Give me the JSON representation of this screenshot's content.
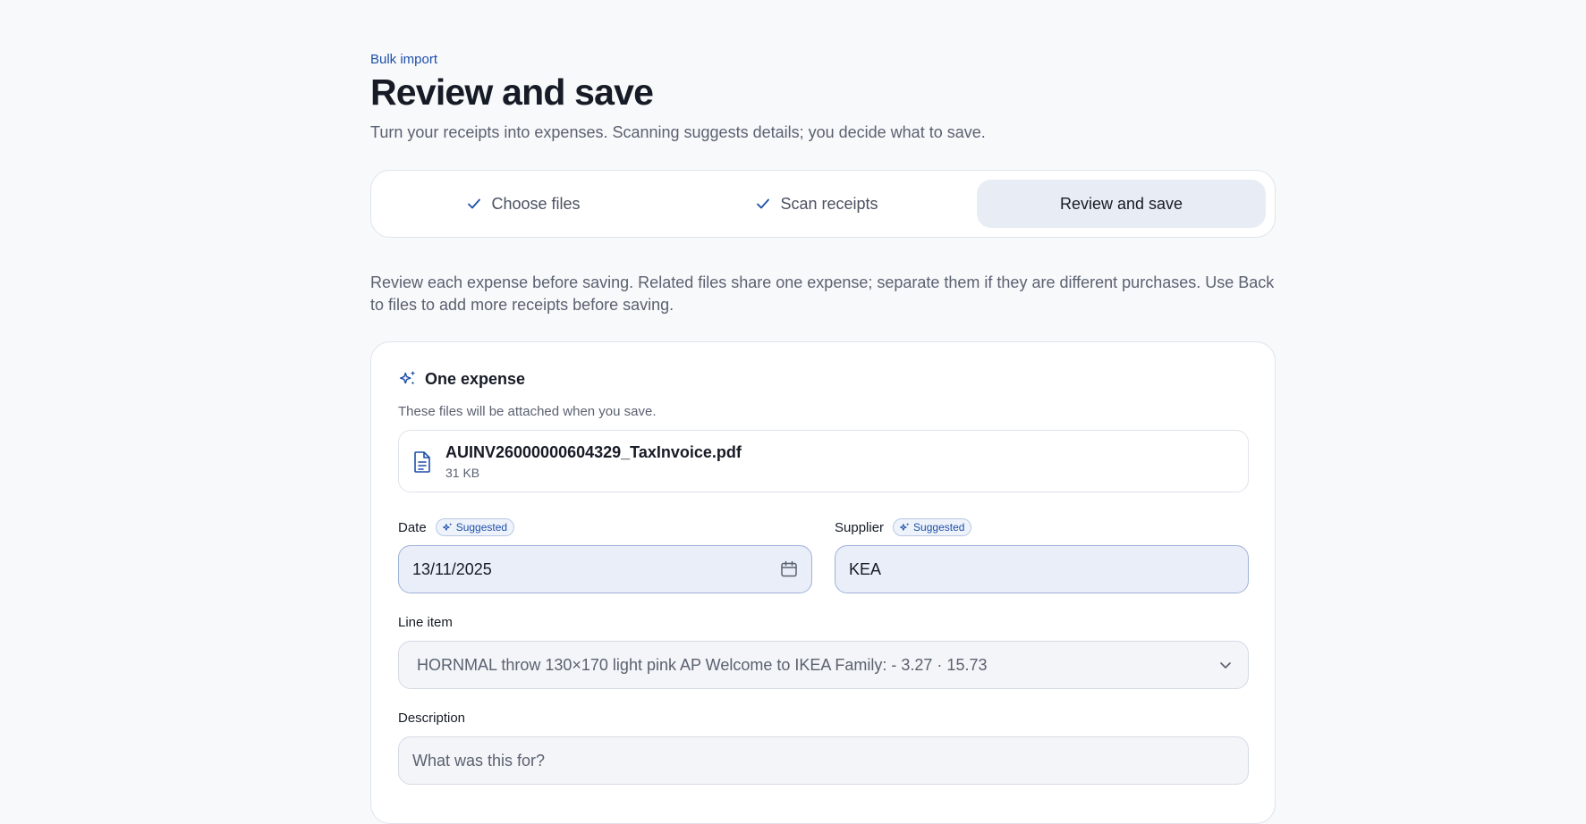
{
  "header": {
    "eyebrow": "Bulk import",
    "title": "Review and save",
    "subtitle": "Turn your receipts into expenses. Scanning suggests details; you decide what to save."
  },
  "steps": [
    {
      "label": "Choose files",
      "state": "done"
    },
    {
      "label": "Scan receipts",
      "state": "done"
    },
    {
      "label": "Review and save",
      "state": "active"
    }
  ],
  "intro": "Review each expense before saving. Related files share one expense; separate them if they are different purchases. Use Back to files to add more receipts before saving.",
  "expense": {
    "title": "One expense",
    "subtitle": "These files will be attached when you save.",
    "file": {
      "name": "AUINV26000000604329_TaxInvoice.pdf",
      "size": "31 KB"
    },
    "suggested_badge": "Suggested",
    "date": {
      "label": "Date",
      "value": "13/11/2025"
    },
    "supplier": {
      "label": "Supplier",
      "value": "KEA"
    },
    "line_item": {
      "label": "Line item",
      "value": "HORNMAL throw 130×170 light pink AP Welcome to IKEA Family: - 3.27 · 15.73"
    },
    "description": {
      "label": "Description",
      "placeholder": "What was this for?",
      "value": ""
    }
  },
  "colors": {
    "accent": "#1e4fa8",
    "suggested_bg": "#e9eef8",
    "active_step_bg": "#e8edf5"
  }
}
